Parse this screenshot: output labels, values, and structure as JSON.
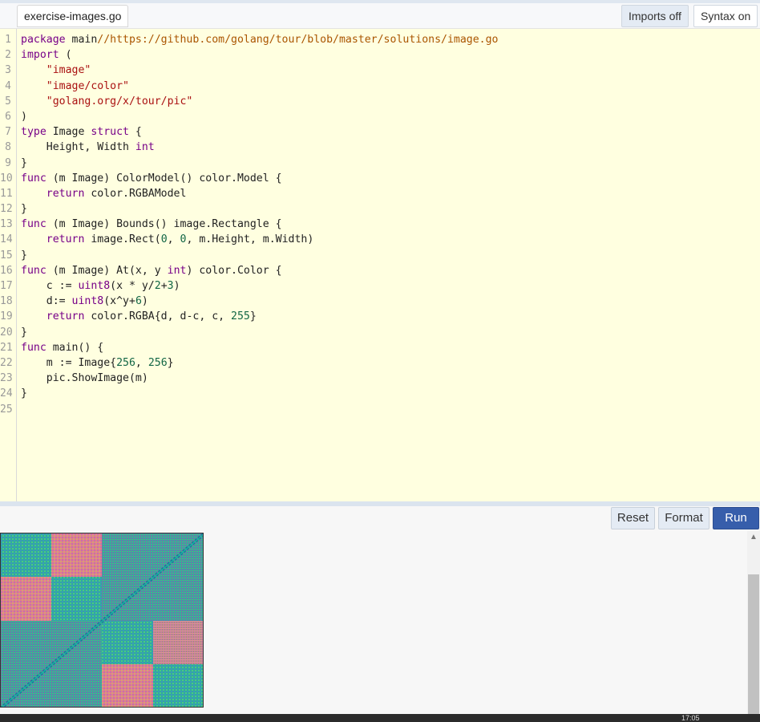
{
  "tab": {
    "filename": "exercise-images.go"
  },
  "toolbar": {
    "imports_label": "Imports off",
    "syntax_label": "Syntax on"
  },
  "actions": {
    "reset_label": "Reset",
    "format_label": "Format",
    "run_label": "Run"
  },
  "taskbar": {
    "clock": "17:05"
  },
  "colors": {
    "editor_bg": "#ffffe0",
    "keyword": "#770088",
    "string": "#aa1111",
    "comment": "#aa5500",
    "number": "#116644",
    "run_button": "#375eab"
  },
  "output": {
    "image_description": "generated 256x256 pattern image"
  },
  "code": {
    "lines": [
      [
        [
          "package",
          "k"
        ],
        [
          " main",
          ""
        ],
        [
          "//https://github.com/golang/tour/blob/master/solutions/image.go",
          "c"
        ]
      ],
      [
        [
          "import",
          "k"
        ],
        [
          " (",
          ""
        ]
      ],
      [
        [
          "    ",
          ""
        ],
        [
          "\"image\"",
          "s"
        ]
      ],
      [
        [
          "    ",
          ""
        ],
        [
          "\"image/color\"",
          "s"
        ]
      ],
      [
        [
          "    ",
          ""
        ],
        [
          "\"golang.org/x/tour/pic\"",
          "s"
        ]
      ],
      [
        [
          ")",
          ""
        ]
      ],
      [
        [
          "type",
          "k"
        ],
        [
          " Image ",
          ""
        ],
        [
          "struct",
          "k"
        ],
        [
          " {",
          ""
        ]
      ],
      [
        [
          "    Height, Width ",
          ""
        ],
        [
          "int",
          "k"
        ]
      ],
      [
        [
          "}",
          ""
        ]
      ],
      [
        [
          "func",
          "k"
        ],
        [
          " (m Image) ColorModel() color.Model {",
          ""
        ]
      ],
      [
        [
          "    ",
          ""
        ],
        [
          "return",
          "k"
        ],
        [
          " color.RGBAModel",
          ""
        ]
      ],
      [
        [
          "}",
          ""
        ]
      ],
      [
        [
          "func",
          "k"
        ],
        [
          " (m Image) Bounds() image.Rectangle {",
          ""
        ]
      ],
      [
        [
          "    ",
          ""
        ],
        [
          "return",
          "k"
        ],
        [
          " image.Rect(",
          ""
        ],
        [
          "0",
          "n"
        ],
        [
          ", ",
          ""
        ],
        [
          "0",
          "n"
        ],
        [
          ", m.Height, m.Width)",
          ""
        ]
      ],
      [
        [
          "}",
          ""
        ]
      ],
      [
        [
          "func",
          "k"
        ],
        [
          " (m Image) At(x, y ",
          ""
        ],
        [
          "int",
          "k"
        ],
        [
          ") color.Color {",
          ""
        ]
      ],
      [
        [
          "    c := ",
          ""
        ],
        [
          "uint8",
          "k"
        ],
        [
          "(x * y/",
          ""
        ],
        [
          "2",
          "n"
        ],
        [
          "+",
          ""
        ],
        [
          "3",
          "n"
        ],
        [
          ")",
          ""
        ]
      ],
      [
        [
          "    d:= ",
          ""
        ],
        [
          "uint8",
          "k"
        ],
        [
          "(x^y+",
          ""
        ],
        [
          "6",
          "n"
        ],
        [
          ")",
          ""
        ]
      ],
      [
        [
          "    ",
          ""
        ],
        [
          "return",
          "k"
        ],
        [
          " color.RGBA{d, d-c, c, ",
          ""
        ],
        [
          "255",
          "n"
        ],
        [
          "}",
          ""
        ]
      ],
      [
        [
          "}",
          ""
        ]
      ],
      [
        [
          "func",
          "k"
        ],
        [
          " main() {",
          ""
        ]
      ],
      [
        [
          "    m := Image{",
          ""
        ],
        [
          "256",
          "n"
        ],
        [
          ", ",
          ""
        ],
        [
          "256",
          "n"
        ],
        [
          "}",
          ""
        ]
      ],
      [
        [
          "    pic.ShowImage(m)",
          ""
        ]
      ],
      [
        [
          "}",
          ""
        ]
      ],
      [
        [
          "",
          ""
        ]
      ]
    ]
  }
}
